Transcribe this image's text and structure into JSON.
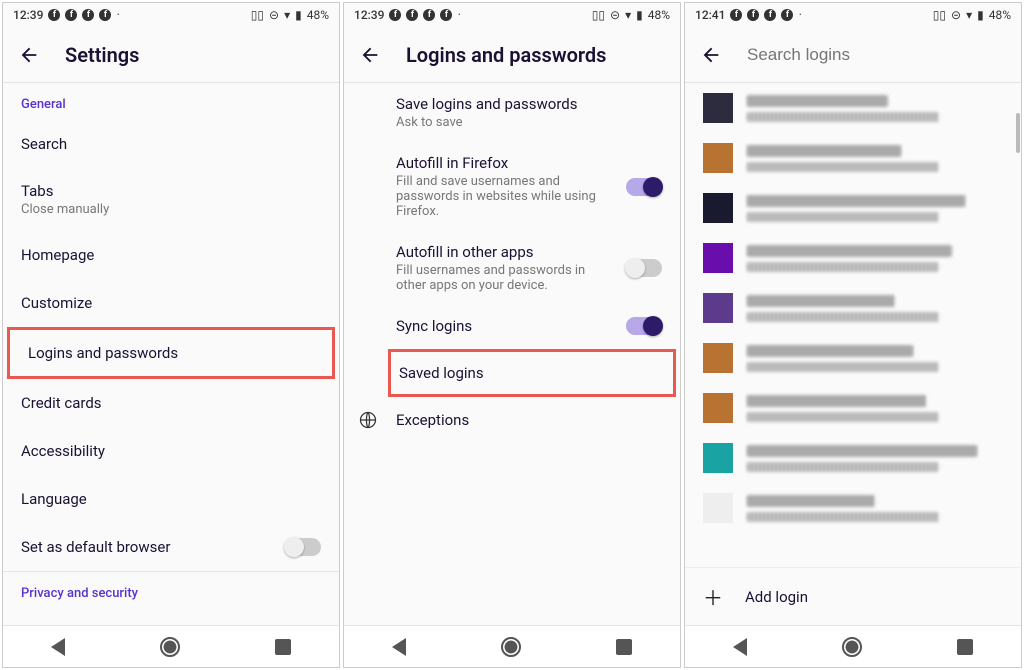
{
  "status": {
    "time_a": "12:39",
    "time_b": "12:39",
    "time_c": "12:41",
    "battery": "48%"
  },
  "screen1": {
    "title": "Settings",
    "section1": "General",
    "items": {
      "search": "Search",
      "tabs": "Tabs",
      "tabs_sub": "Close manually",
      "homepage": "Homepage",
      "customize": "Customize",
      "logins": "Logins and passwords",
      "credit": "Credit cards",
      "accessibility": "Accessibility",
      "language": "Language",
      "default": "Set as default browser"
    },
    "section2": "Privacy and security"
  },
  "screen2": {
    "title": "Logins and passwords",
    "rows": {
      "save_title": "Save logins and passwords",
      "save_sub": "Ask to save",
      "autofill_ff_title": "Autofill in Firefox",
      "autofill_ff_sub": "Fill and save usernames and passwords in websites while using Firefox.",
      "autofill_other_title": "Autofill in other apps",
      "autofill_other_sub": "Fill usernames and passwords in other apps on your device.",
      "sync": "Sync logins",
      "saved": "Saved logins",
      "exceptions": "Exceptions"
    },
    "toggles": {
      "autofill_ff": true,
      "autofill_other": false,
      "sync": true
    }
  },
  "screen3": {
    "search_placeholder": "Search logins",
    "add_login": "Add login",
    "favicons": [
      "#2c2c3e",
      "#b87333",
      "#1a1a2e",
      "#6a0dad",
      "#5c3b8c",
      "#b87333",
      "#b87333",
      "#1aa3a3",
      "#eeeeee"
    ]
  }
}
